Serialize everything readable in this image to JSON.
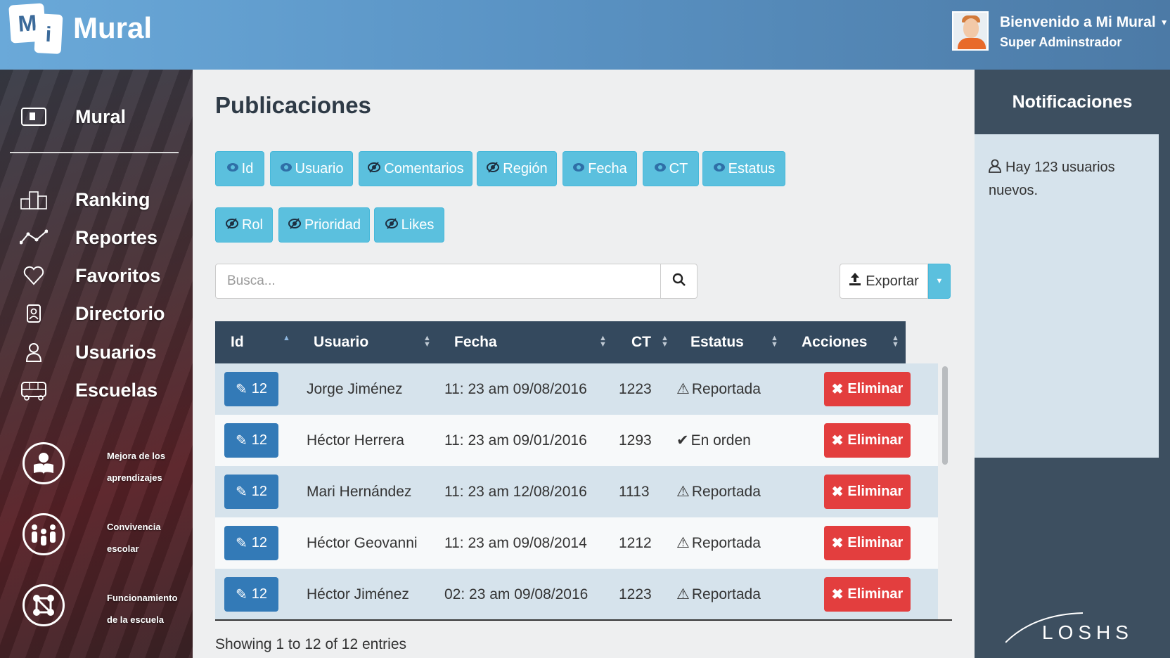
{
  "app": {
    "logo_letters": [
      "M",
      "i"
    ],
    "logo_text": "Mural"
  },
  "header": {
    "welcome": "Bienvenido a Mi Mural",
    "role": "Super Adminstrador"
  },
  "sidebar": {
    "items": [
      {
        "label": "Mural",
        "icon": "mural-icon"
      },
      {
        "label": "Ranking",
        "icon": "podium-icon"
      },
      {
        "label": "Reportes",
        "icon": "line-chart-icon"
      },
      {
        "label": "Favoritos",
        "icon": "heart-icon"
      },
      {
        "label": "Directorio",
        "icon": "badge-icon"
      },
      {
        "label": "Usuarios",
        "icon": "user-icon"
      },
      {
        "label": "Escuelas",
        "icon": "bus-icon"
      }
    ],
    "circles": [
      {
        "line1": "Mejora de los",
        "line2": "aprendizajes",
        "icon": "student-reading-icon"
      },
      {
        "line1": "Convivencia",
        "line2": "escolar",
        "icon": "people-group-icon"
      },
      {
        "line1": "Funcionamiento",
        "line2": "de la escuela",
        "icon": "network-icon"
      }
    ]
  },
  "main": {
    "title": "Publicaciones",
    "column_toggles_row1": [
      {
        "label": "Id",
        "visible": true
      },
      {
        "label": "Usuario",
        "visible": true
      },
      {
        "label": "Comentarios",
        "visible": false
      },
      {
        "label": "Región",
        "visible": false
      },
      {
        "label": "Fecha",
        "visible": true
      },
      {
        "label": "CT",
        "visible": true
      },
      {
        "label": "Estatus",
        "visible": true
      }
    ],
    "column_toggles_row2": [
      {
        "label": "Rol",
        "visible": false
      },
      {
        "label": "Prioridad",
        "visible": false
      },
      {
        "label": "Likes",
        "visible": false
      }
    ],
    "search": {
      "placeholder": "Busca...",
      "value": ""
    },
    "export_label": "Exportar",
    "table": {
      "headers": [
        "Id",
        "Usuario",
        "Fecha",
        "CT",
        "Estatus",
        "Acciones"
      ],
      "rows": [
        {
          "id": "12",
          "usuario": "Jorge Jiménez",
          "fecha": "11: 23 am 09/08/2016",
          "ct": "1223",
          "estatus": "Reportada",
          "status_icon": "warning-icon",
          "action": "Eliminar"
        },
        {
          "id": "12",
          "usuario": "Héctor Herrera",
          "fecha": "11: 23 am 09/01/2016",
          "ct": "1293",
          "estatus": "En orden",
          "status_icon": "check-icon",
          "action": "Eliminar"
        },
        {
          "id": "12",
          "usuario": "Mari Hernández",
          "fecha": "11: 23 am 12/08/2016",
          "ct": "1113",
          "estatus": "Reportada",
          "status_icon": "warning-icon",
          "action": "Eliminar"
        },
        {
          "id": "12",
          "usuario": "Héctor Geovanni",
          "fecha": "11: 23 am 09/08/2014",
          "ct": "1212",
          "estatus": "Reportada",
          "status_icon": "warning-icon",
          "action": "Eliminar"
        },
        {
          "id": "12",
          "usuario": "Héctor Jiménez",
          "fecha": "02: 23 am 09/08/2016",
          "ct": "1223",
          "estatus": "Reportada",
          "status_icon": "warning-icon",
          "action": "Eliminar"
        }
      ]
    },
    "showing": "Showing 1 to 12 of 12 entries"
  },
  "notifications": {
    "title": "Notificaciones",
    "message": "Hay 123 usuarios nuevos.",
    "brand": "LOSHS"
  },
  "colors": {
    "info": "#5bc0de",
    "primary": "#337ab7",
    "danger": "#e33e3e",
    "table_header": "#34495e"
  }
}
